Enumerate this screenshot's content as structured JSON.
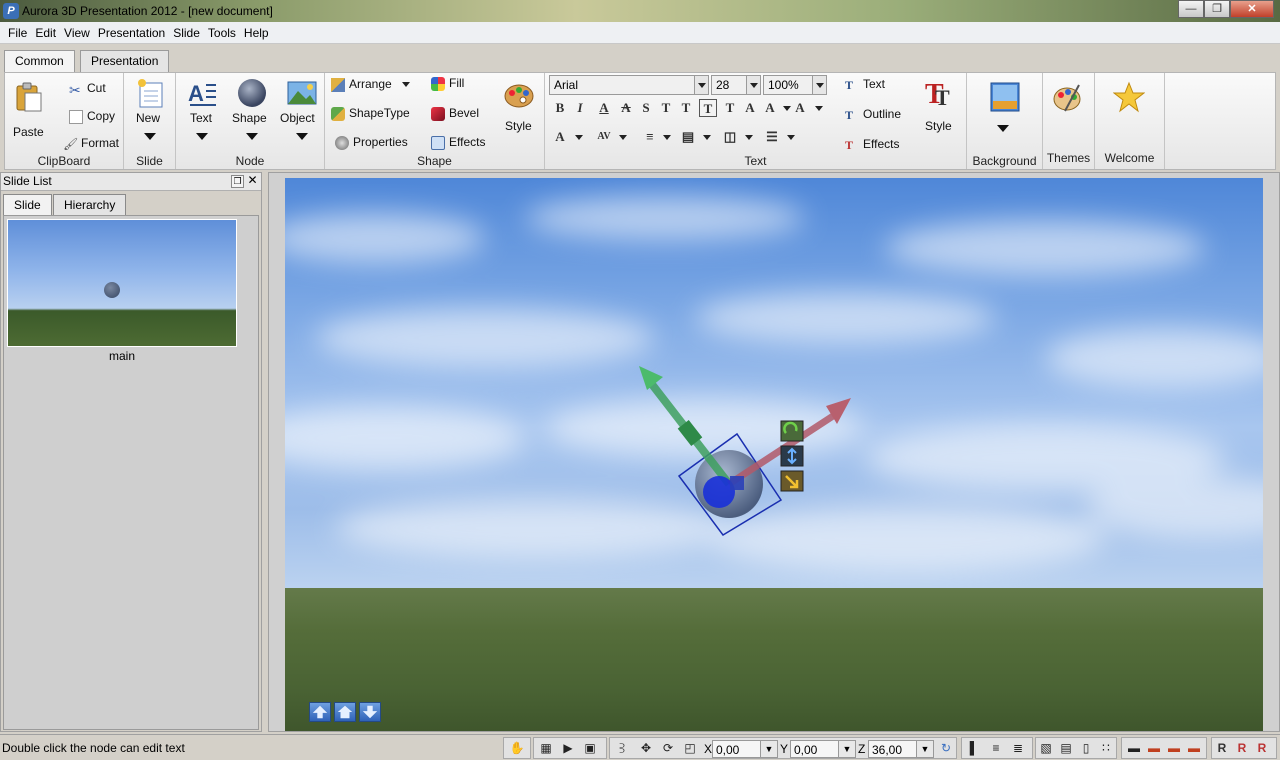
{
  "window": {
    "title": "Aurora 3D Presentation 2012 - [new document]",
    "app_icon": "P"
  },
  "menu": [
    "File",
    "Edit",
    "View",
    "Presentation",
    "Slide",
    "Tools",
    "Help"
  ],
  "ribbon_tabs": [
    "Common",
    "Presentation"
  ],
  "ribbon": {
    "clipboard": {
      "paste": "Paste",
      "cut": "Cut",
      "copy": "Copy",
      "format": "Format",
      "label": "ClipBoard"
    },
    "slide": {
      "new": "New",
      "label": "Slide"
    },
    "node": {
      "text": "Text",
      "shape": "Shape",
      "object": "Object",
      "label": "Node"
    },
    "shape": {
      "arrange": "Arrange",
      "shapetype": "ShapeType",
      "properties": "Properties",
      "fill": "Fill",
      "bevel": "Bevel",
      "effects": "Effects",
      "style": "Style",
      "label": "Shape"
    },
    "text": {
      "font": "Arial",
      "size": "28",
      "zoom": "100%",
      "text_btn": "Text",
      "outline": "Outline",
      "effects": "Effects",
      "style": "Style",
      "label": "Text"
    },
    "background": {
      "label": "Background"
    },
    "themes": {
      "label": "Themes"
    },
    "welcome": {
      "label": "Welcome"
    }
  },
  "slide_panel": {
    "title": "Slide List",
    "tabs": [
      "Slide",
      "Hierarchy"
    ],
    "slides": [
      {
        "label": "main"
      }
    ]
  },
  "status": {
    "message": "Double click the node can edit text",
    "x_label": "X",
    "x_value": "0,00",
    "y_label": "Y",
    "y_value": "0,00",
    "z_label": "Z",
    "z_value": "36,00"
  }
}
